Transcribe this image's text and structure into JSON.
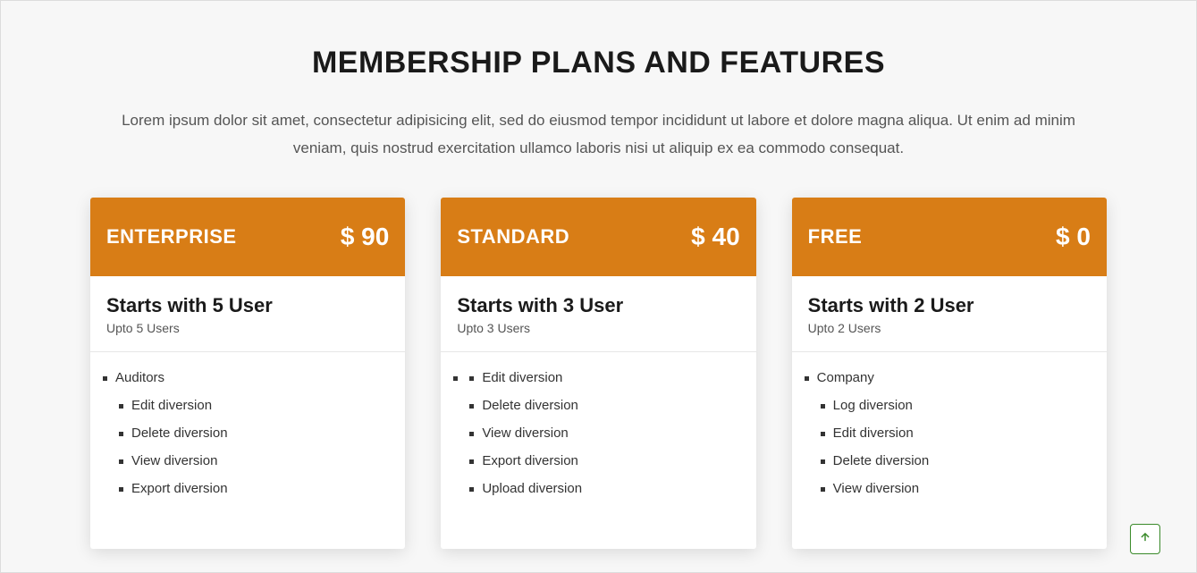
{
  "header": {
    "title": "MEMBERSHIP PLANS AND FEATURES",
    "subtitle": "Lorem ipsum dolor sit amet, consectetur adipisicing elit, sed do eiusmod tempor incididunt ut labore et dolore magna aliqua. Ut enim ad minim veniam, quis nostrud exercitation ullamco laboris nisi ut aliquip ex ea commodo consequat."
  },
  "plans": [
    {
      "name": "ENTERPRISE",
      "price": "$ 90",
      "starts": "Starts with 5 User",
      "upto": "Upto 5 Users",
      "group_label": "Auditors",
      "features": [
        "Edit diversion",
        "Delete diversion",
        "View diversion",
        "Export diversion"
      ]
    },
    {
      "name": "STANDARD",
      "price": "$ 40",
      "starts": "Starts with 3 User",
      "upto": "Upto 3 Users",
      "group_label": "",
      "features": [
        "Edit diversion",
        "Delete diversion",
        "View diversion",
        "Export diversion",
        "Upload diversion"
      ]
    },
    {
      "name": "FREE",
      "price": "$ 0",
      "starts": "Starts with 2 User",
      "upto": "Upto 2 Users",
      "group_label": "Company",
      "features": [
        "Log diversion",
        "Edit diversion",
        "Delete diversion",
        "View diversion"
      ]
    }
  ],
  "colors": {
    "accent": "#d87d16",
    "scroll_thumb": "#3a8a2a"
  }
}
